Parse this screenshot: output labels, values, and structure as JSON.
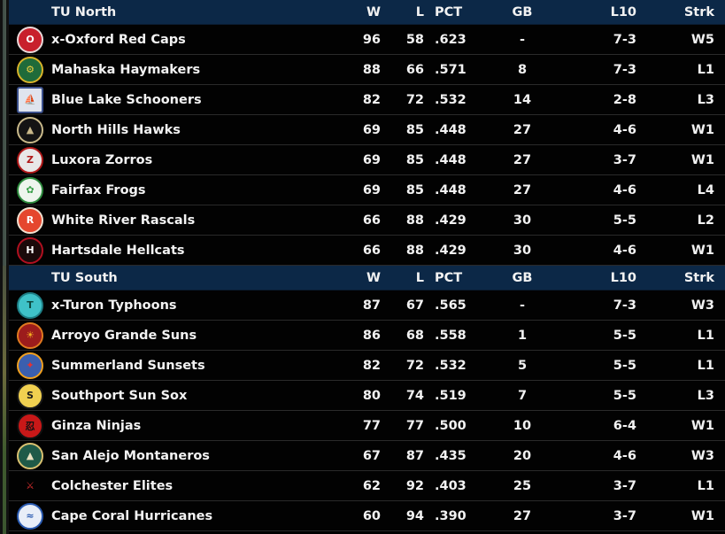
{
  "columns": {
    "w": "W",
    "l": "L",
    "pct": "PCT",
    "gb": "GB",
    "l10": "L10",
    "strk": "Strk"
  },
  "divisions": [
    {
      "name": "TU North",
      "teams": [
        {
          "name": "x-Oxford Red Caps",
          "w": "96",
          "l": "58",
          "pct": ".623",
          "gb": "-",
          "l10": "7-3",
          "strk": "W5",
          "logo": {
            "icon": "oxford-red-caps-logo",
            "bg": "#c8202c",
            "ring": "#e8d9d9",
            "glyph": "O",
            "fg": "#ffffff"
          }
        },
        {
          "name": "Mahaska Haymakers",
          "w": "88",
          "l": "66",
          "pct": ".571",
          "gb": "8",
          "l10": "7-3",
          "strk": "L1",
          "logo": {
            "icon": "mahaska-haymakers-logo",
            "bg": "#1f6b3a",
            "ring": "#d8b42a",
            "glyph": "⚙",
            "fg": "#f0d040"
          }
        },
        {
          "name": "Blue Lake Schooners",
          "w": "82",
          "l": "72",
          "pct": ".532",
          "gb": "14",
          "l10": "2-8",
          "strk": "L3",
          "logo": {
            "icon": "blue-lake-schooners-logo",
            "bg": "#dfe4ee",
            "ring": "#3a4f8a",
            "glyph": "⛵",
            "fg": "#3b2a10"
          }
        },
        {
          "name": "North Hills Hawks",
          "w": "69",
          "l": "85",
          "pct": ".448",
          "gb": "27",
          "l10": "4-6",
          "strk": "W1",
          "logo": {
            "icon": "north-hills-hawks-logo",
            "bg": "#141414",
            "ring": "#c9b98a",
            "glyph": "▲",
            "fg": "#c9b98a"
          }
        },
        {
          "name": "Luxora Zorros",
          "w": "69",
          "l": "85",
          "pct": ".448",
          "gb": "27",
          "l10": "3-7",
          "strk": "W1",
          "logo": {
            "icon": "luxora-zorros-logo",
            "bg": "#e8e8e8",
            "ring": "#b11a1a",
            "glyph": "Z",
            "fg": "#b11a1a"
          }
        },
        {
          "name": "Fairfax Frogs",
          "w": "69",
          "l": "85",
          "pct": ".448",
          "gb": "27",
          "l10": "4-6",
          "strk": "L4",
          "logo": {
            "icon": "fairfax-frogs-logo",
            "bg": "#eef5ee",
            "ring": "#2e8b3e",
            "glyph": "✿",
            "fg": "#3aa04a"
          }
        },
        {
          "name": "White River Rascals",
          "w": "66",
          "l": "88",
          "pct": ".429",
          "gb": "30",
          "l10": "5-5",
          "strk": "L2",
          "logo": {
            "icon": "white-river-rascals-logo",
            "bg": "#e5472e",
            "ring": "#f0e0d0",
            "glyph": "R",
            "fg": "#ffffff"
          }
        },
        {
          "name": "Hartsdale Hellcats",
          "w": "66",
          "l": "88",
          "pct": ".429",
          "gb": "30",
          "l10": "4-6",
          "strk": "W1",
          "logo": {
            "icon": "hartsdale-hellcats-logo",
            "bg": "#1a0a0a",
            "ring": "#b01020",
            "glyph": "H",
            "fg": "#ffffff"
          }
        }
      ]
    },
    {
      "name": "TU South",
      "teams": [
        {
          "name": "x-Turon Typhoons",
          "w": "87",
          "l": "67",
          "pct": ".565",
          "gb": "-",
          "l10": "7-3",
          "strk": "W3",
          "logo": {
            "icon": "turon-typhoons-logo",
            "bg": "#3fc2c8",
            "ring": "#1e7f86",
            "glyph": "T",
            "fg": "#0e4a40"
          }
        },
        {
          "name": "Arroyo Grande Suns",
          "w": "86",
          "l": "68",
          "pct": ".558",
          "gb": "1",
          "l10": "5-5",
          "strk": "L1",
          "logo": {
            "icon": "arroyo-grande-suns-logo",
            "bg": "#9c1c1c",
            "ring": "#e07a20",
            "glyph": "☀",
            "fg": "#f5b020"
          }
        },
        {
          "name": "Summerland Sunsets",
          "w": "82",
          "l": "72",
          "pct": ".532",
          "gb": "5",
          "l10": "5-5",
          "strk": "L1",
          "logo": {
            "icon": "summerland-sunsets-logo",
            "bg": "#3b5fae",
            "ring": "#f0a020",
            "glyph": "✦",
            "fg": "#e83030"
          }
        },
        {
          "name": "Southport Sun Sox",
          "w": "80",
          "l": "74",
          "pct": ".519",
          "gb": "7",
          "l10": "5-5",
          "strk": "L3",
          "logo": {
            "icon": "southport-sun-sox-logo",
            "bg": "#f0d050",
            "ring": "#1a1a1a",
            "glyph": "S",
            "fg": "#1a1a1a"
          }
        },
        {
          "name": "Ginza Ninjas",
          "w": "77",
          "l": "77",
          "pct": ".500",
          "gb": "10",
          "l10": "6-4",
          "strk": "W1",
          "logo": {
            "icon": "ginza-ninjas-logo",
            "bg": "#c81818",
            "ring": "#111111",
            "glyph": "忍",
            "fg": "#111111"
          }
        },
        {
          "name": "San Alejo Montaneros",
          "w": "67",
          "l": "87",
          "pct": ".435",
          "gb": "20",
          "l10": "4-6",
          "strk": "W3",
          "logo": {
            "icon": "san-alejo-montaneros-logo",
            "bg": "#1f5a48",
            "ring": "#d8c070",
            "glyph": "▲",
            "fg": "#e8e0c0"
          }
        },
        {
          "name": "Colchester Elites",
          "w": "62",
          "l": "92",
          "pct": ".403",
          "gb": "25",
          "l10": "3-7",
          "strk": "L1",
          "logo": {
            "icon": "colchester-elites-logo",
            "bg": "transparent",
            "ring": "transparent",
            "glyph": "⚔",
            "fg": "#d83030"
          }
        },
        {
          "name": "Cape Coral Hurricanes",
          "w": "60",
          "l": "94",
          "pct": ".390",
          "gb": "27",
          "l10": "3-7",
          "strk": "W1",
          "logo": {
            "icon": "cape-coral-hurricanes-logo",
            "bg": "#e8eef8",
            "ring": "#2a5ab0",
            "glyph": "≈",
            "fg": "#2a5ab0"
          }
        }
      ]
    }
  ]
}
